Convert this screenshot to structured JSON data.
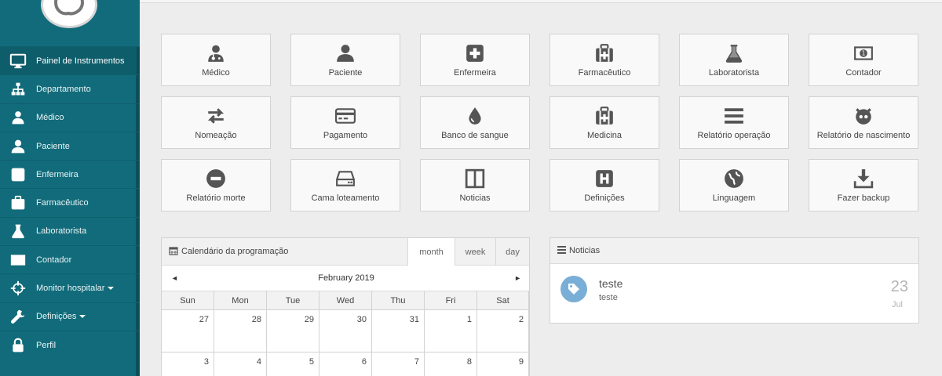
{
  "sidebar": {
    "items": [
      {
        "label": "Painel de Instrumentos",
        "icon": "monitor-icon",
        "active": true
      },
      {
        "label": "Departamento",
        "icon": "sitemap-icon"
      },
      {
        "label": "Médico",
        "icon": "doctor-icon"
      },
      {
        "label": "Paciente",
        "icon": "user-icon"
      },
      {
        "label": "Enfermeira",
        "icon": "plus-square-icon"
      },
      {
        "label": "Farmacêutico",
        "icon": "medkit-icon"
      },
      {
        "label": "Laboratorista",
        "icon": "flask-icon"
      },
      {
        "label": "Contador",
        "icon": "money-icon"
      },
      {
        "label": "Monitor hospitalar",
        "icon": "crosshairs-icon",
        "dropdown": true
      },
      {
        "label": "Definições",
        "icon": "wrench-icon",
        "dropdown": true
      },
      {
        "label": "Perfil",
        "icon": "lock-icon"
      }
    ]
  },
  "tiles": [
    {
      "label": "Médico",
      "icon": "doctor-icon"
    },
    {
      "label": "Paciente",
      "icon": "user-icon"
    },
    {
      "label": "Enfermeira",
      "icon": "plus-square-icon"
    },
    {
      "label": "Farmacêutico",
      "icon": "medkit-icon"
    },
    {
      "label": "Laboratorista",
      "icon": "flask-icon"
    },
    {
      "label": "Contador",
      "icon": "money-icon"
    },
    {
      "label": "Nomeação",
      "icon": "exchange-icon"
    },
    {
      "label": "Pagamento",
      "icon": "credit-card-icon"
    },
    {
      "label": "Banco de sangue",
      "icon": "tint-icon"
    },
    {
      "label": "Medicina",
      "icon": "medkit-icon"
    },
    {
      "label": "Relatório operação",
      "icon": "bars-icon"
    },
    {
      "label": "Relatório de nascimento",
      "icon": "github-icon"
    },
    {
      "label": "Relatório morte",
      "icon": "minus-circle-icon"
    },
    {
      "label": "Cama loteamento",
      "icon": "hdd-icon"
    },
    {
      "label": "Noticias",
      "icon": "columns-icon"
    },
    {
      "label": "Definições",
      "icon": "h-square-icon"
    },
    {
      "label": "Linguagem",
      "icon": "globe-icon"
    },
    {
      "label": "Fazer backup",
      "icon": "download-icon"
    }
  ],
  "calendar": {
    "title": "Calendário da programação",
    "views": [
      "month",
      "week",
      "day"
    ],
    "active_view": "month",
    "month_label": "February 2019",
    "prev_symbol": "◄",
    "next_symbol": "►",
    "days_of_week": [
      "Sun",
      "Mon",
      "Tue",
      "Wed",
      "Thu",
      "Fri",
      "Sat"
    ],
    "weeks": [
      [
        "27",
        "28",
        "29",
        "30",
        "31",
        "1",
        "2"
      ],
      [
        "3",
        "4",
        "5",
        "6",
        "7",
        "8",
        "9"
      ]
    ]
  },
  "news": {
    "title": "Noticias",
    "items": [
      {
        "title": "teste",
        "description": "teste",
        "day": "23",
        "month": "Jul",
        "icon": "tag-icon"
      }
    ]
  },
  "colors": {
    "sidebar_bg": "#116b7a",
    "tile_icon": "#555555",
    "news_badge": "#79aed6"
  }
}
